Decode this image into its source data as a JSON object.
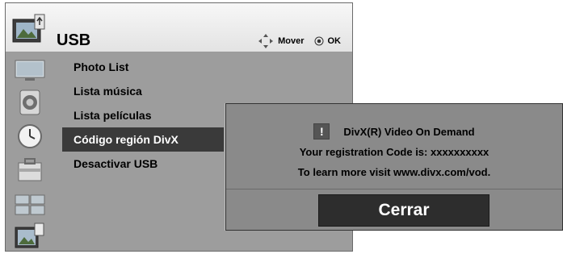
{
  "menu": {
    "title": "USB",
    "hints": {
      "move_label": "Mover",
      "ok_label": "OK"
    },
    "items": [
      {
        "label": "Photo List"
      },
      {
        "label": "Lista música"
      },
      {
        "label": "Lista películas"
      },
      {
        "label": "Código región DivX",
        "selected": true
      },
      {
        "label": "Desactivar USB"
      }
    ],
    "side_icons": [
      "tv-screen-icon",
      "speaker-icon",
      "clock-icon",
      "toolbox-icon",
      "input-screens-icon",
      "usb-photo-icon"
    ]
  },
  "dialog": {
    "warning_symbol": "!",
    "title": "DivX(R) Video On Demand",
    "registration_line": "Your registration Code is: xxxxxxxxxx",
    "info_line": "To learn more visit www.divx.com/vod.",
    "close_label": "Cerrar"
  },
  "colors": {
    "menu_background": "#9d9d9d",
    "selected_item": "#3a3a3a",
    "dialog_background": "#8a8a8a",
    "button_background": "#2d2d2d"
  }
}
